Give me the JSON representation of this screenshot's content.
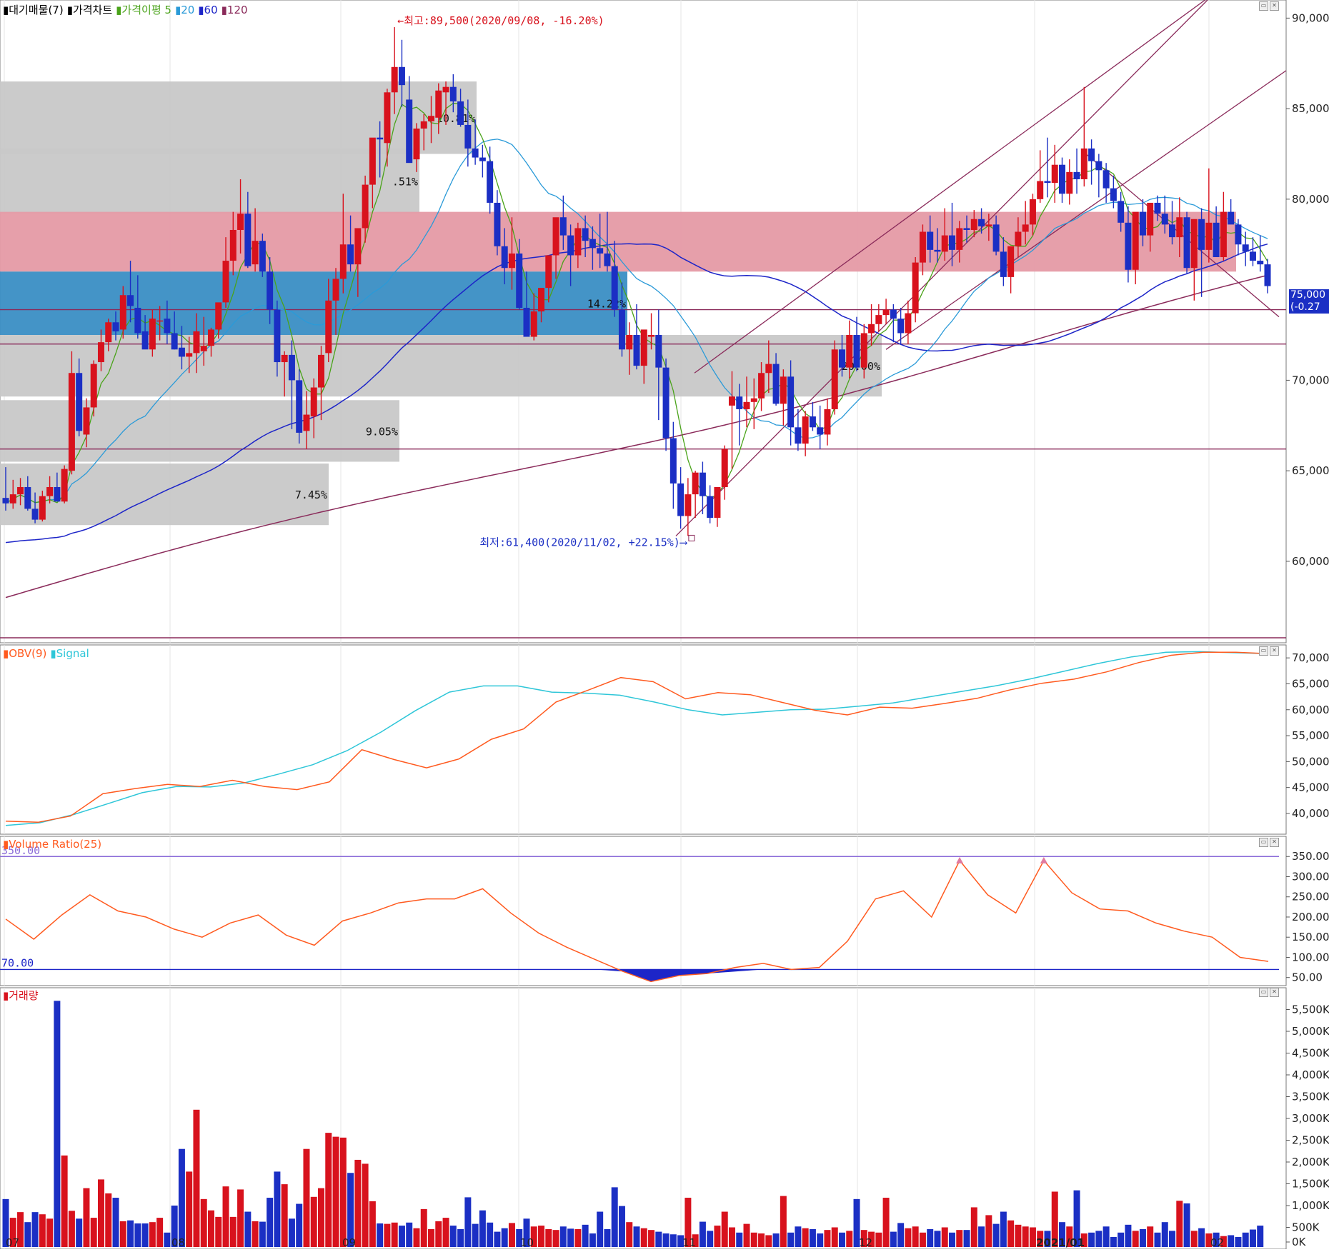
{
  "price_pane": {
    "legend": [
      {
        "label": "대기매물(7)",
        "color": "#000000"
      },
      {
        "label": "가격차트",
        "color": "#000000"
      },
      {
        "label": "가격이평 5",
        "color": "#4aa31a"
      },
      {
        "label": "20",
        "color": "#2a9ad8"
      },
      {
        "label": "60",
        "color": "#1d25c8"
      },
      {
        "label": "120",
        "color": "#8a2a5a"
      }
    ],
    "high_annotation": "←최고:89,500(2020/09/08, -16.20%)",
    "low_annotation": "최저:61,400(2020/11/02, +22.15%)⟶",
    "y_ticks": [
      "90,000",
      "85,000",
      "80,000",
      "75,000",
      "70,000",
      "65,000",
      "60,000"
    ],
    "current_price_label": "75,000",
    "current_change_label": "(-0.27"
  },
  "obv_pane": {
    "legend": [
      {
        "label": "OBV(9)",
        "color": "#ff5a1f"
      },
      {
        "label": "Signal",
        "color": "#2ec6d8"
      }
    ],
    "y_ticks": [
      "70,000",
      "65,000",
      "60,000",
      "55,000",
      "50,000",
      "45,000",
      "40,000"
    ]
  },
  "vr_pane": {
    "legend": [
      {
        "label": "Volume Ratio(25)",
        "color": "#ff5a1f"
      }
    ],
    "level_high_label": "350.00",
    "level_low_label": "70.00",
    "y_ticks": [
      "350.00",
      "300.00",
      "250.00",
      "200.00",
      "150.00",
      "100.00",
      "50.00"
    ]
  },
  "volume_pane": {
    "legend": [
      {
        "label": "거래량",
        "color": "#d8121d"
      }
    ],
    "y_ticks": [
      "5,500K",
      "5,000K",
      "4,500K",
      "4,000K",
      "3,500K",
      "3,000K",
      "2,500K",
      "2,000K",
      "1,500K",
      "1,000K",
      "500K",
      "0K"
    ]
  },
  "x_axis_labels": [
    "07",
    "08",
    "09",
    "10",
    "11",
    "12",
    "2021/01",
    "02"
  ],
  "colors": {
    "up": "#d8121d",
    "down": "#1b2fc4",
    "ma5": "#4aa31a",
    "ma20": "#2a9ad8",
    "ma60": "#1d25c8",
    "ma120": "#8a2a5a",
    "obv": "#ff5a1f",
    "signal": "#2ec6d8",
    "supply_gray": "#c8c8c8",
    "supply_red": "#e59aa5",
    "supply_blue": "#3a8ec4"
  },
  "chart_data": {
    "type": "candlestick",
    "supply_zones": [
      {
        "from": 82500,
        "to": 86500,
        "label": "10.81%"
      },
      {
        "from": 79200,
        "to": 82800,
        "label": ".51%"
      },
      {
        "from": 76000,
        "to": 79300,
        "label": ""
      },
      {
        "from": 72500,
        "to": 76000,
        "label": "14.22%"
      },
      {
        "from": 69100,
        "to": 72500,
        "label": "20.00%"
      },
      {
        "from": 65500,
        "to": 68900,
        "label": "9.05%"
      },
      {
        "from": 62000,
        "to": 65400,
        "label": "7.45%"
      }
    ],
    "horizontal_levels": [
      73900,
      72000,
      66200
    ],
    "candles_ohlc": [
      [
        63500,
        65200,
        62800,
        63200
      ],
      [
        63200,
        64500,
        62900,
        63700
      ],
      [
        63700,
        64600,
        63100,
        64100
      ],
      [
        64100,
        64700,
        62800,
        62900
      ],
      [
        62900,
        63800,
        62100,
        62300
      ],
      [
        62300,
        63900,
        62200,
        63600
      ],
      [
        63600,
        64700,
        63200,
        64100
      ],
      [
        64100,
        64900,
        63300,
        63300
      ],
      [
        63300,
        65300,
        63200,
        65100
      ],
      [
        65000,
        71600,
        64800,
        70400
      ],
      [
        70400,
        71200,
        66900,
        67200
      ],
      [
        67000,
        69000,
        66300,
        68500
      ],
      [
        68500,
        71100,
        68000,
        70900
      ],
      [
        71000,
        72800,
        70500,
        72100
      ],
      [
        72100,
        73400,
        71600,
        73200
      ],
      [
        73200,
        73800,
        72200,
        72700
      ],
      [
        72800,
        75200,
        72300,
        74700
      ],
      [
        74700,
        76600,
        73200,
        74100
      ],
      [
        74000,
        75800,
        72300,
        72600
      ],
      [
        72700,
        73600,
        71800,
        71700
      ],
      [
        71700,
        73900,
        71300,
        73400
      ],
      [
        73300,
        74100,
        72200,
        73300
      ],
      [
        73400,
        74400,
        72000,
        72600
      ],
      [
        72600,
        73800,
        71700,
        71700
      ],
      [
        71800,
        73000,
        70600,
        71300
      ],
      [
        71300,
        72400,
        70400,
        71500
      ],
      [
        71500,
        73700,
        70400,
        72700
      ],
      [
        71600,
        73500,
        70800,
        71900
      ],
      [
        71900,
        72900,
        71300,
        72800
      ],
      [
        72800,
        74100,
        72300,
        74300
      ],
      [
        74300,
        77900,
        74000,
        76600
      ],
      [
        76600,
        79300,
        75800,
        78300
      ],
      [
        78300,
        81100,
        77000,
        79200
      ],
      [
        79200,
        80400,
        76200,
        76300
      ],
      [
        76400,
        79500,
        76000,
        77700
      ],
      [
        77700,
        78100,
        75700,
        76000
      ],
      [
        76000,
        76800,
        73100,
        73900
      ],
      [
        73900,
        74400,
        70200,
        71000
      ],
      [
        71000,
        71600,
        69100,
        71400
      ],
      [
        71400,
        72200,
        67300,
        70000
      ],
      [
        70000,
        70600,
        66500,
        67100
      ],
      [
        67200,
        69400,
        66200,
        68100
      ],
      [
        68000,
        70100,
        66800,
        69600
      ],
      [
        69600,
        71900,
        67800,
        71400
      ],
      [
        71500,
        75600,
        71000,
        74400
      ],
      [
        74400,
        76200,
        72500,
        75600
      ],
      [
        75600,
        80300,
        74800,
        77500
      ],
      [
        77500,
        79100,
        76000,
        76400
      ],
      [
        76400,
        77800,
        74600,
        78400
      ],
      [
        78400,
        81300,
        77600,
        80800
      ],
      [
        80800,
        83300,
        79500,
        83400
      ],
      [
        83400,
        84300,
        81200,
        83300
      ],
      [
        83100,
        86100,
        81800,
        85900
      ],
      [
        85900,
        89500,
        84700,
        87300
      ],
      [
        87300,
        88800,
        85100,
        86300
      ],
      [
        85500,
        86800,
        82900,
        82000
      ],
      [
        82200,
        84200,
        81500,
        83900
      ],
      [
        83900,
        84700,
        82700,
        84300
      ],
      [
        84300,
        85700,
        83100,
        84600
      ],
      [
        84500,
        86400,
        83600,
        86000
      ],
      [
        85900,
        86500,
        84100,
        86200
      ],
      [
        86200,
        86900,
        84800,
        85400
      ],
      [
        85400,
        86100,
        84000,
        84100
      ],
      [
        84100,
        85500,
        81800,
        82800
      ],
      [
        82800,
        84400,
        81900,
        82300
      ],
      [
        82300,
        83000,
        81200,
        82100
      ],
      [
        82100,
        82900,
        79200,
        79800
      ],
      [
        79800,
        80500,
        76900,
        77400
      ],
      [
        77400,
        78400,
        75300,
        76200
      ],
      [
        76200,
        79000,
        75000,
        77000
      ],
      [
        77000,
        77800,
        73900,
        74000
      ],
      [
        74000,
        76000,
        72500,
        72400
      ],
      [
        72400,
        74800,
        72200,
        73800
      ],
      [
        73800,
        75000,
        73200,
        75100
      ],
      [
        75100,
        76900,
        74300,
        76900
      ],
      [
        76900,
        78300,
        75600,
        79000
      ],
      [
        79000,
        80200,
        77200,
        78000
      ],
      [
        78000,
        78600,
        75200,
        76900
      ],
      [
        76900,
        78700,
        76200,
        78400
      ],
      [
        78400,
        79100,
        76800,
        77700
      ],
      [
        77800,
        78500,
        76100,
        77300
      ],
      [
        77300,
        79200,
        76200,
        77000
      ],
      [
        77000,
        79300,
        76000,
        76300
      ],
      [
        76300,
        77700,
        73500,
        73900
      ],
      [
        73900,
        75400,
        71300,
        71700
      ],
      [
        71700,
        73200,
        70300,
        72500
      ],
      [
        72500,
        74200,
        70600,
        70800
      ],
      [
        70800,
        72400,
        69800,
        72800
      ],
      [
        72400,
        73700,
        71700,
        72500
      ],
      [
        72500,
        73900,
        67800,
        70700
      ],
      [
        70700,
        71200,
        66100,
        66800
      ],
      [
        66800,
        67700,
        62900,
        64300
      ],
      [
        64300,
        65200,
        61800,
        62500
      ],
      [
        62500,
        64600,
        61400,
        63700
      ],
      [
        63700,
        65000,
        62400,
        64900
      ],
      [
        64900,
        65500,
        62600,
        63600
      ],
      [
        63600,
        64200,
        62100,
        62400
      ],
      [
        62400,
        64100,
        61900,
        64100
      ],
      [
        64100,
        66400,
        63400,
        66200
      ],
      [
        68600,
        70500,
        65100,
        69100
      ],
      [
        69100,
        69800,
        66400,
        68400
      ],
      [
        68400,
        70200,
        67400,
        68800
      ],
      [
        68800,
        70100,
        67300,
        69000
      ],
      [
        69000,
        71000,
        68300,
        70400
      ],
      [
        70400,
        72200,
        69300,
        70900
      ],
      [
        70900,
        71500,
        68600,
        68700
      ],
      [
        68700,
        70600,
        67500,
        70200
      ],
      [
        70200,
        71100,
        66400,
        67400
      ],
      [
        67400,
        68400,
        66100,
        66500
      ],
      [
        66500,
        68300,
        65800,
        68000
      ],
      [
        68000,
        68800,
        67200,
        67400
      ],
      [
        67400,
        68600,
        66200,
        67000
      ],
      [
        67000,
        69000,
        66400,
        68400
      ],
      [
        68400,
        72200,
        68100,
        71700
      ],
      [
        71700,
        72500,
        70200,
        70700
      ],
      [
        70700,
        73300,
        70100,
        72500
      ],
      [
        72500,
        73500,
        70500,
        70700
      ],
      [
        70700,
        73100,
        70100,
        72600
      ],
      [
        72600,
        74200,
        71900,
        73100
      ],
      [
        73100,
        74200,
        72700,
        73600
      ],
      [
        73600,
        74500,
        73100,
        73900
      ],
      [
        73900,
        74200,
        72100,
        73400
      ],
      [
        73400,
        74000,
        72000,
        72600
      ],
      [
        72600,
        74400,
        72000,
        73700
      ],
      [
        73700,
        76800,
        73200,
        76500
      ],
      [
        76500,
        78600,
        75800,
        78200
      ],
      [
        78200,
        79100,
        76500,
        77200
      ],
      [
        77200,
        78400,
        76500,
        77100
      ],
      [
        77100,
        79500,
        76600,
        78000
      ],
      [
        78000,
        79800,
        76300,
        77200
      ],
      [
        77200,
        78800,
        76500,
        78400
      ],
      [
        78400,
        79100,
        77600,
        78300
      ],
      [
        78300,
        79400,
        77900,
        78900
      ],
      [
        78900,
        79500,
        78100,
        78500
      ],
      [
        78500,
        79200,
        77700,
        78600
      ],
      [
        78600,
        79100,
        76900,
        77100
      ],
      [
        77100,
        77900,
        75200,
        75700
      ],
      [
        75700,
        77300,
        74800,
        77400
      ],
      [
        77400,
        79000,
        76800,
        78200
      ],
      [
        78200,
        79900,
        77500,
        78600
      ],
      [
        78600,
        80300,
        78000,
        80000
      ],
      [
        80000,
        82700,
        79800,
        81000
      ],
      [
        81000,
        83400,
        80100,
        80900
      ],
      [
        80900,
        83000,
        79800,
        81900
      ],
      [
        81900,
        82300,
        79800,
        80300
      ],
      [
        80300,
        82200,
        79700,
        81500
      ],
      [
        81500,
        82800,
        80300,
        81100
      ],
      [
        81100,
        86200,
        80700,
        82800
      ],
      [
        82800,
        83300,
        80800,
        82100
      ],
      [
        82100,
        82500,
        80100,
        81600
      ],
      [
        81600,
        82000,
        79800,
        80600
      ],
      [
        80600,
        81300,
        79500,
        79900
      ],
      [
        79900,
        80400,
        78200,
        78700
      ],
      [
        78700,
        79600,
        75400,
        76100
      ],
      [
        76100,
        78800,
        75300,
        79300
      ],
      [
        79300,
        80000,
        77400,
        78000
      ],
      [
        78000,
        79600,
        77100,
        79800
      ],
      [
        79800,
        80200,
        78800,
        79200
      ],
      [
        79200,
        80200,
        78100,
        78600
      ],
      [
        78600,
        79900,
        77500,
        77900
      ],
      [
        77900,
        80100,
        76800,
        79000
      ],
      [
        79000,
        79300,
        75900,
        76200
      ],
      [
        76200,
        78400,
        74400,
        78900
      ],
      [
        78900,
        79500,
        74600,
        77200
      ],
      [
        77200,
        81700,
        76500,
        78700
      ],
      [
        78700,
        79600,
        76800,
        76800
      ],
      [
        76800,
        80400,
        76600,
        79300
      ],
      [
        79300,
        80000,
        78800,
        78600
      ],
      [
        78600,
        78900,
        76900,
        77500
      ],
      [
        77500,
        78200,
        76300,
        77100
      ],
      [
        77100,
        77900,
        76300,
        76600
      ],
      [
        76600,
        78000,
        76000,
        76400
      ],
      [
        76400,
        76700,
        74800,
        75200
      ]
    ],
    "volume_k": [
      1150,
      720,
      850,
      620,
      850,
      800,
      700,
      5700,
      2150,
      880,
      700,
      1400,
      720,
      1600,
      1280,
      1180,
      640,
      660,
      590,
      590,
      620,
      720,
      380,
      1000,
      2300,
      1780,
      3200,
      1150,
      890,
      740,
      1440,
      740,
      1370,
      860,
      640,
      630,
      1180,
      1780,
      1490,
      700,
      1040,
      2300,
      1200,
      1400,
      2670,
      2580,
      2560,
      1750,
      2050,
      1960,
      1100,
      590,
      580,
      610,
      540,
      610,
      480,
      920,
      460,
      640,
      720,
      540,
      460,
      1190,
      580,
      890,
      610,
      400,
      480,
      600,
      460,
      700,
      520,
      540,
      460,
      440,
      520,
      470,
      460,
      560,
      360,
      860,
      460,
      1420,
      990,
      620,
      520,
      480,
      440,
      400,
      360,
      340,
      320,
      1180,
      340,
      630,
      420,
      540,
      860,
      500,
      380,
      580,
      380,
      360,
      320,
      360,
      1220,
      380,
      520,
      480,
      460,
      360,
      440,
      500,
      380,
      420,
      1150,
      440,
      400,
      380,
      1180,
      400,
      600,
      480,
      520,
      380,
      460,
      420,
      500,
      380,
      440,
      440,
      960,
      520,
      780,
      580,
      860,
      660,
      560,
      520,
      500,
      420,
      420,
      1320,
      620,
      520,
      1350,
      360,
      380,
      420,
      520,
      280,
      380,
      560,
      420,
      460,
      520,
      380,
      620,
      420,
      1110,
      1050,
      420,
      480,
      360,
      380,
      300,
      320,
      280,
      380,
      450,
      540
    ],
    "obv_path_anchor_values": [
      38500,
      38300,
      39500,
      43800,
      44800,
      45600,
      45200,
      46400,
      45200,
      44600,
      46100,
      52300,
      50400,
      48800,
      50500,
      54300,
      56300,
      61500,
      63800,
      66200,
      65400,
      62100,
      63300,
      62900,
      61400,
      59900,
      59000,
      60500,
      60300,
      61200,
      62200,
      63800,
      65100,
      65900,
      67300,
      69100,
      70500,
      71100,
      71100,
      70800
    ],
    "signal_path_anchor_values": [
      37700,
      38200,
      39800,
      41900,
      44000,
      45200,
      45100,
      45900,
      47600,
      49400,
      52100,
      55700,
      59800,
      63400,
      64600,
      64600,
      63400,
      63200,
      62800,
      61500,
      60000,
      59000,
      59500,
      60000,
      60100,
      60700,
      61300,
      62400,
      63500,
      64600,
      65900,
      67400,
      68900,
      70200,
      71100,
      71200,
      71000,
      70800
    ],
    "volume_ratio_anchor_values": [
      195,
      145,
      205,
      255,
      215,
      200,
      170,
      150,
      185,
      205,
      155,
      130,
      190,
      210,
      235,
      245,
      245,
      270,
      210,
      160,
      125,
      95,
      65,
      40,
      55,
      60,
      75,
      85,
      70,
      75,
      140,
      245,
      265,
      200,
      340,
      255,
      210,
      340,
      260,
      220,
      215,
      185,
      165,
      150,
      100,
      90
    ]
  }
}
